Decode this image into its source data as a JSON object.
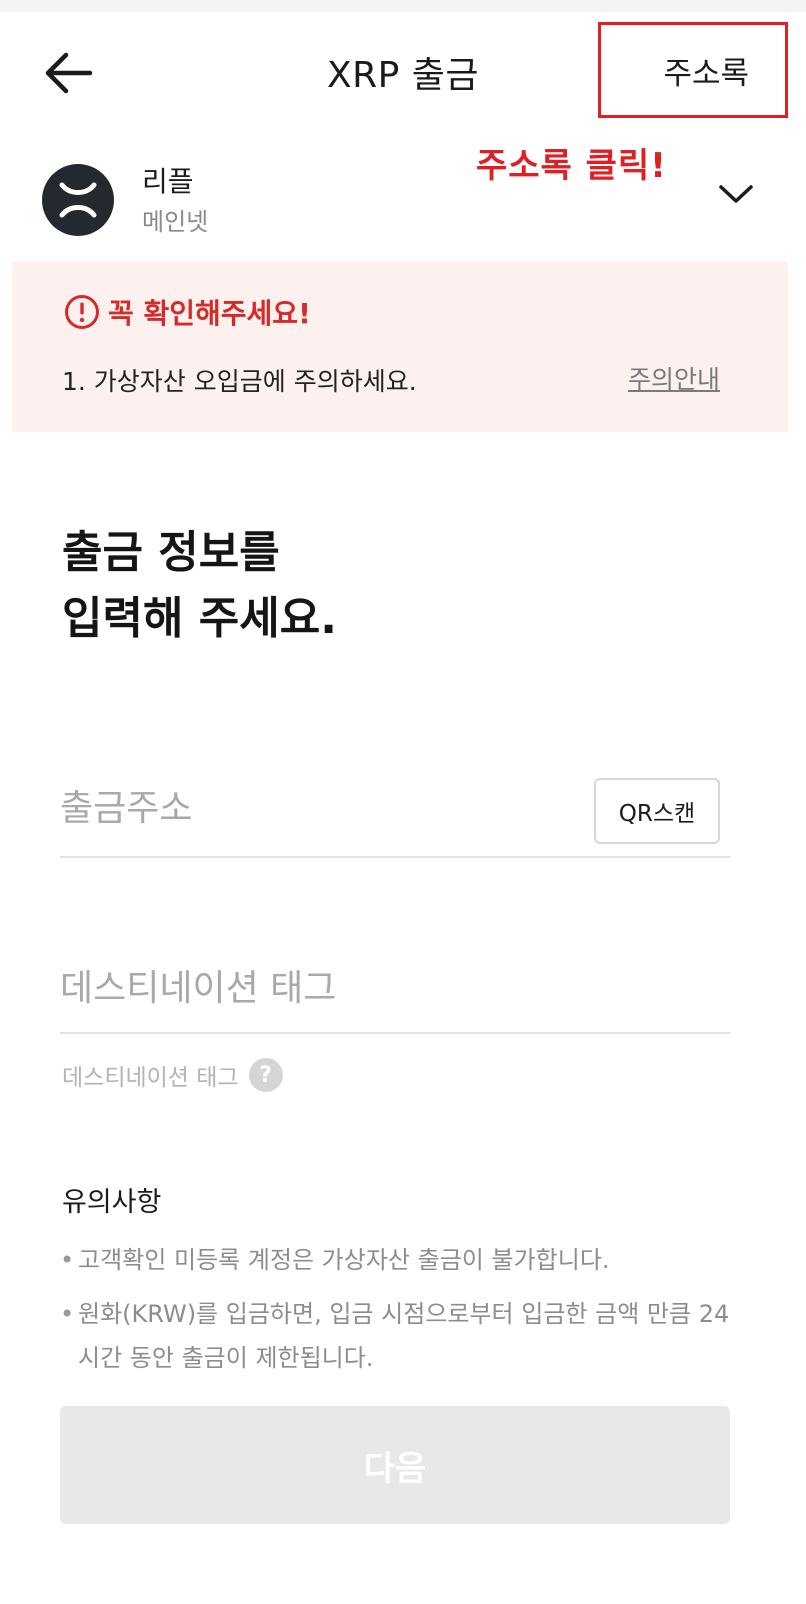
{
  "header": {
    "title": "XRP 출금",
    "address_book_label": "주소록",
    "annotation": "주소록 클릭!"
  },
  "coin": {
    "name": "리플",
    "network": "메인넷",
    "logo_icon": "xrp-logo-icon",
    "logo_color": "#23292f"
  },
  "notice": {
    "title": "꼭 확인해주세요!",
    "item": "1. 가상자산 오입금에 주의하세요.",
    "link": "주의안내",
    "accent_color": "#d52b28"
  },
  "heading": {
    "line1": "출금 정보를",
    "line2": "입력해 주세요."
  },
  "form": {
    "address_placeholder": "출금주소",
    "qr_label": "QR스캔",
    "tag_placeholder": "데스티네이션 태그",
    "tag_help_label": "데스티네이션 태그",
    "help_symbol": "?"
  },
  "cautions": {
    "title": "유의사항",
    "items": [
      "고객확인 미등록 계정은 가상자산 출금이 불가합니다.",
      "원화(KRW)를 입금하면, 입금 시점으로부터 입금한 금액 만큼 24시간 동안 출금이 제한됩니다."
    ]
  },
  "next_button": {
    "label": "다음"
  }
}
